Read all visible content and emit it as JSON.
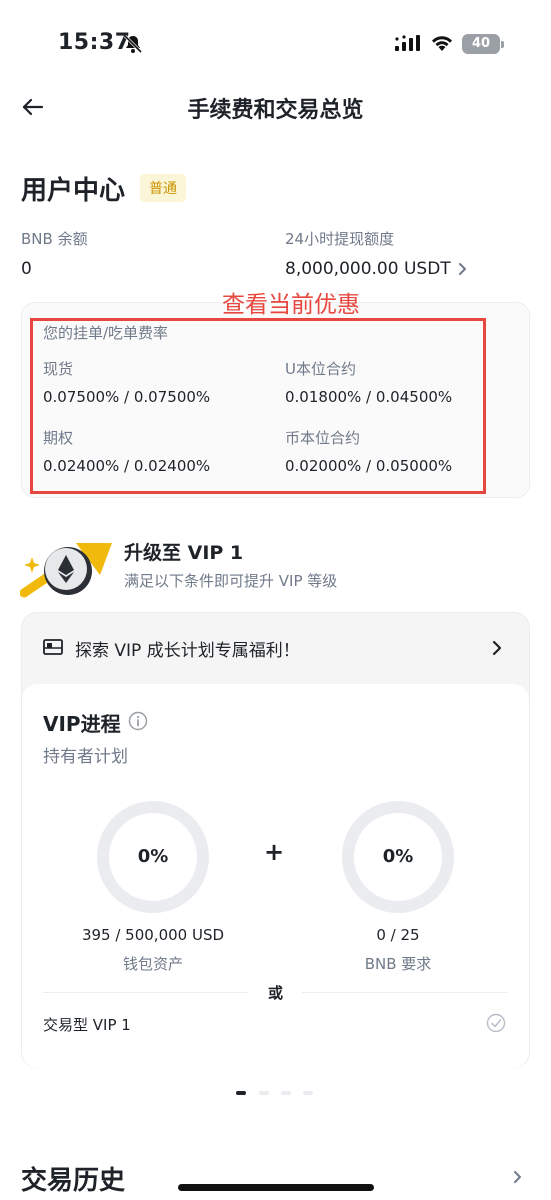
{
  "status_bar": {
    "time": "15:37",
    "battery": "40"
  },
  "header": {
    "title": "手续费和交易总览"
  },
  "user_center": {
    "title": "用户中心",
    "level_badge": "普通",
    "bnb_balance_label": "BNB 余额",
    "bnb_balance_value": "0",
    "withdraw_limit_label": "24小时提现额度",
    "withdraw_limit_value": "8,000,000.00 USDT"
  },
  "annotation": {
    "text": "查看当前优惠"
  },
  "fee_card": {
    "title": "您的挂单/吃单费率",
    "spot_label": "现货",
    "spot_value": "0.07500% / 0.07500%",
    "usdm_label": "U本位合约",
    "usdm_value": "0.01800% / 0.04500%",
    "options_label": "期权",
    "options_value": "0.02400% / 0.02400%",
    "coinm_label": "币本位合约",
    "coinm_value": "0.02000% / 0.05000%"
  },
  "upgrade": {
    "title": "升级至 VIP 1",
    "subtitle": "满足以下条件即可提升 VIP 等级"
  },
  "vip_card": {
    "explore_label": "探索 VIP 成长计划专属福利！",
    "progress_title": "VIP进程",
    "holder_plan": "持有者计划",
    "wallet_progress": {
      "percent": "0%",
      "amount": "395 / 500,000 USD",
      "label": "钱包资产"
    },
    "plus": "+",
    "bnb_progress": {
      "percent": "0%",
      "amount": "0 / 25",
      "label": "BNB 要求"
    },
    "or_label": "或",
    "trade_vip_label": "交易型 VIP 1"
  },
  "trade_history": {
    "title": "交易历史"
  },
  "colors": {
    "brand_yellow": "#f0b90b",
    "annotation_red": "#e8473f",
    "badge_bg": "#fcf6d9"
  }
}
